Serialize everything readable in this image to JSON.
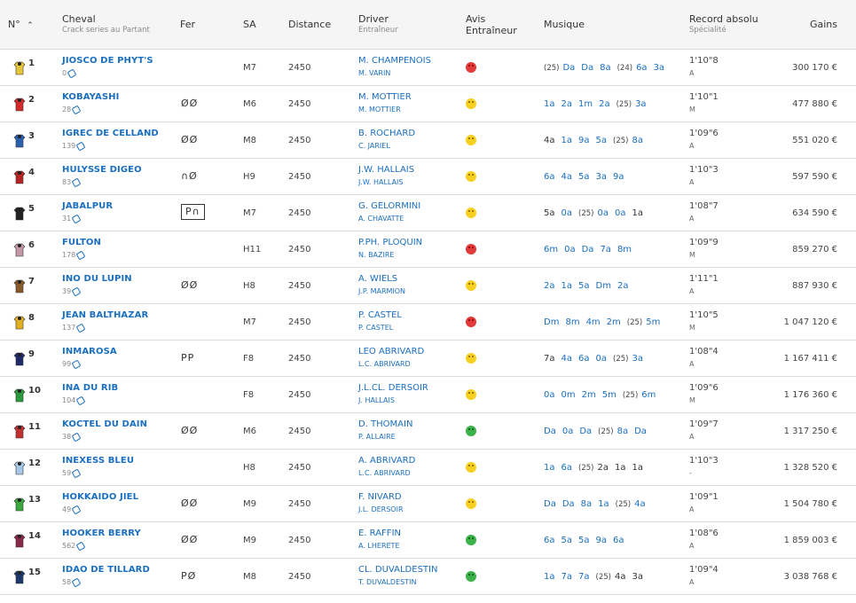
{
  "headers": {
    "num": "N°",
    "cheval": "Cheval",
    "cheval_sub": "Crack series au Partant",
    "fer": "Fer",
    "sa": "SA",
    "distance": "Distance",
    "driver": "Driver",
    "driver_sub": "Entraîneur",
    "avis1": "Avis",
    "avis2": "Entraîneur",
    "musique": "Musique",
    "record": "Record absolu",
    "record_sub": "Spécialité",
    "gains": "Gains"
  },
  "rows": [
    {
      "num": "1",
      "jersey": "#e8c63a",
      "name": "JIOSCO DE PHYT'S",
      "meta": "0",
      "fer": "",
      "ferbox": false,
      "sa": "M7",
      "dist": "2450",
      "driver": "M. CHAMPENOIS",
      "trainer": "M. VARIN",
      "avis": "bad",
      "mus": [
        {
          "y": "(25)"
        },
        {
          "m": "Da"
        },
        {
          "m": "Da"
        },
        {
          "m": "8a"
        },
        {
          "y": "(24)"
        },
        {
          "m": "6a"
        },
        {
          "m": "3a"
        }
      ],
      "record": "1'10\"8",
      "spec": "A",
      "gains": "300 170 €"
    },
    {
      "num": "2",
      "jersey": "#d42a2a",
      "name": "KOBAYASHI",
      "meta": "28",
      "fer": "ØØ",
      "ferbox": false,
      "sa": "M6",
      "dist": "2450",
      "driver": "M. MOTTIER",
      "trainer": "M. MOTTIER",
      "avis": "mid",
      "mus": [
        {
          "m": "1a"
        },
        {
          "m": "2a"
        },
        {
          "m": "1m"
        },
        {
          "m": "2a"
        },
        {
          "y": "(25)"
        },
        {
          "m": "3a"
        }
      ],
      "record": "1'10\"1",
      "spec": "M",
      "gains": "477 880 €"
    },
    {
      "num": "3",
      "jersey": "#2a5fb0",
      "name": "IGREC DE CELLAND",
      "meta": "139",
      "fer": "ØØ",
      "ferbox": false,
      "sa": "M8",
      "dist": "2450",
      "driver": "B. ROCHARD",
      "trainer": "C. JARIEL",
      "avis": "mid",
      "mus": [
        {
          "m": "4a",
          "d": true
        },
        {
          "m": "1a"
        },
        {
          "m": "9a"
        },
        {
          "m": "5a"
        },
        {
          "y": "(25)"
        },
        {
          "m": "8a"
        }
      ],
      "record": "1'09\"6",
      "spec": "A",
      "gains": "551 020 €"
    },
    {
      "num": "4",
      "jersey": "#b82424",
      "name": "HULYSSE DIGEO",
      "meta": "83",
      "fer": "∩Ø",
      "ferbox": false,
      "sa": "H9",
      "dist": "2450",
      "driver": "J.W. HALLAIS",
      "trainer": "J.W. HALLAIS",
      "avis": "mid",
      "mus": [
        {
          "m": "6a"
        },
        {
          "m": "4a"
        },
        {
          "m": "5a"
        },
        {
          "m": "3a"
        },
        {
          "m": "9a"
        }
      ],
      "record": "1'10\"3",
      "spec": "A",
      "gains": "597 590 €"
    },
    {
      "num": "5",
      "jersey": "#222222",
      "name": "JABALPUR",
      "meta": "31",
      "fer": "P∩",
      "ferbox": true,
      "sa": "M7",
      "dist": "2450",
      "driver": "G. GELORMINI",
      "trainer": "A. CHAVATTE",
      "avis": "mid",
      "mus": [
        {
          "m": "5a",
          "d": true
        },
        {
          "m": "0a"
        },
        {
          "y": "(25)"
        },
        {
          "m": "0a"
        },
        {
          "m": "0a"
        },
        {
          "m": "1a",
          "d": true
        }
      ],
      "record": "1'08\"7",
      "spec": "A",
      "gains": "634 590 €"
    },
    {
      "num": "6",
      "jersey": "#c49aa8",
      "name": "FULTON",
      "meta": "178",
      "fer": "",
      "ferbox": false,
      "sa": "H11",
      "dist": "2450",
      "driver": "P.PH. PLOQUIN",
      "trainer": "N. BAZIRE",
      "avis": "bad",
      "mus": [
        {
          "m": "6m"
        },
        {
          "m": "0a"
        },
        {
          "m": "Da"
        },
        {
          "m": "7a"
        },
        {
          "m": "8m"
        }
      ],
      "record": "1'09\"9",
      "spec": "M",
      "gains": "859 270 €"
    },
    {
      "num": "7",
      "jersey": "#8a5a2a",
      "name": "INO DU LUPIN",
      "meta": "39",
      "fer": "ØØ",
      "ferbox": false,
      "sa": "H8",
      "dist": "2450",
      "driver": "A. WIELS",
      "trainer": "J.P. MARMION",
      "avis": "mid",
      "mus": [
        {
          "m": "2a"
        },
        {
          "m": "1a"
        },
        {
          "m": "5a"
        },
        {
          "m": "Dm"
        },
        {
          "m": "2a"
        }
      ],
      "record": "1'11\"1",
      "spec": "A",
      "gains": "887 930 €"
    },
    {
      "num": "8",
      "jersey": "#e2b020",
      "name": "JEAN BALTHAZAR",
      "meta": "137",
      "fer": "",
      "ferbox": false,
      "sa": "M7",
      "dist": "2450",
      "driver": "P. CASTEL",
      "trainer": "P. CASTEL",
      "avis": "bad",
      "mus": [
        {
          "m": "Dm"
        },
        {
          "m": "8m"
        },
        {
          "m": "4m"
        },
        {
          "m": "2m"
        },
        {
          "y": "(25)"
        },
        {
          "m": "5m"
        }
      ],
      "record": "1'10\"5",
      "spec": "M",
      "gains": "1 047 120 €"
    },
    {
      "num": "9",
      "jersey": "#1e2a6a",
      "name": "INMAROSA",
      "meta": "99",
      "fer": "PP",
      "ferbox": false,
      "sa": "F8",
      "dist": "2450",
      "driver": "LEO ABRIVARD",
      "trainer": "L.C. ABRIVARD",
      "avis": "mid",
      "mus": [
        {
          "m": "7a",
          "d": true
        },
        {
          "m": "4a"
        },
        {
          "m": "6a"
        },
        {
          "m": "0a"
        },
        {
          "y": "(25)"
        },
        {
          "m": "3a"
        }
      ],
      "record": "1'08\"4",
      "spec": "A",
      "gains": "1 167 411 €"
    },
    {
      "num": "10",
      "jersey": "#2a9a3a",
      "name": "INA DU RIB",
      "meta": "104",
      "fer": "",
      "ferbox": false,
      "sa": "F8",
      "dist": "2450",
      "driver": "J.L.CL. DERSOIR",
      "trainer": "J. HALLAIS",
      "avis": "mid",
      "mus": [
        {
          "m": "0a"
        },
        {
          "m": "0m"
        },
        {
          "m": "2m"
        },
        {
          "m": "5m"
        },
        {
          "y": "(25)"
        },
        {
          "m": "6m"
        }
      ],
      "record": "1'09\"6",
      "spec": "M",
      "gains": "1 176 360 €"
    },
    {
      "num": "11",
      "jersey": "#c23030",
      "name": "KOCTEL DU DAIN",
      "meta": "38",
      "fer": "ØØ",
      "ferbox": false,
      "sa": "M6",
      "dist": "2450",
      "driver": "D. THOMAIN",
      "trainer": "P. ALLAIRE",
      "avis": "good",
      "mus": [
        {
          "m": "Da"
        },
        {
          "m": "0a"
        },
        {
          "m": "Da"
        },
        {
          "y": "(25)"
        },
        {
          "m": "8a"
        },
        {
          "m": "Da"
        }
      ],
      "record": "1'09\"7",
      "spec": "A",
      "gains": "1 317 250 €"
    },
    {
      "num": "12",
      "jersey": "#a8c8e8",
      "name": "INEXESS BLEU",
      "meta": "59",
      "fer": "",
      "ferbox": false,
      "sa": "H8",
      "dist": "2450",
      "driver": "A. ABRIVARD",
      "trainer": "L.C. ABRIVARD",
      "avis": "mid",
      "mus": [
        {
          "m": "1a"
        },
        {
          "m": "6a"
        },
        {
          "y": "(25)"
        },
        {
          "m": "2a",
          "d": true
        },
        {
          "m": "1a",
          "d": true
        },
        {
          "m": "1a",
          "d": true
        }
      ],
      "record": "1'10\"3",
      "spec": "-",
      "gains": "1 328 520 €"
    },
    {
      "num": "13",
      "jersey": "#3aa83a",
      "name": "HOKKAIDO JIEL",
      "meta": "49",
      "fer": "ØØ",
      "ferbox": false,
      "sa": "M9",
      "dist": "2450",
      "driver": "F. NIVARD",
      "trainer": "J.L. DERSOIR",
      "avis": "mid",
      "mus": [
        {
          "m": "Da"
        },
        {
          "m": "Da"
        },
        {
          "m": "8a"
        },
        {
          "m": "1a"
        },
        {
          "y": "(25)"
        },
        {
          "m": "4a"
        }
      ],
      "record": "1'09\"1",
      "spec": "A",
      "gains": "1 504 780 €"
    },
    {
      "num": "14",
      "jersey": "#8a2a4a",
      "name": "HOOKER BERRY",
      "meta": "562",
      "fer": "ØØ",
      "ferbox": false,
      "sa": "M9",
      "dist": "2450",
      "driver": "E. RAFFIN",
      "trainer": "A. LHERETE",
      "avis": "good",
      "mus": [
        {
          "m": "6a"
        },
        {
          "m": "5a"
        },
        {
          "m": "5a"
        },
        {
          "m": "9a"
        },
        {
          "m": "6a"
        }
      ],
      "record": "1'08\"6",
      "spec": "A",
      "gains": "1 859 003 €"
    },
    {
      "num": "15",
      "jersey": "#1e3a6a",
      "name": "IDAO DE TILLARD",
      "meta": "58",
      "fer": "PØ",
      "ferbox": false,
      "sa": "M8",
      "dist": "2450",
      "driver": "CL. DUVALDESTIN",
      "trainer": "T. DUVALDESTIN",
      "avis": "good",
      "mus": [
        {
          "m": "1a"
        },
        {
          "m": "7a"
        },
        {
          "m": "7a"
        },
        {
          "y": "(25)"
        },
        {
          "m": "4a",
          "d": true
        },
        {
          "m": "3a",
          "d": true
        }
      ],
      "record": "1'09\"4",
      "spec": "A",
      "gains": "3 038 768 €"
    }
  ]
}
